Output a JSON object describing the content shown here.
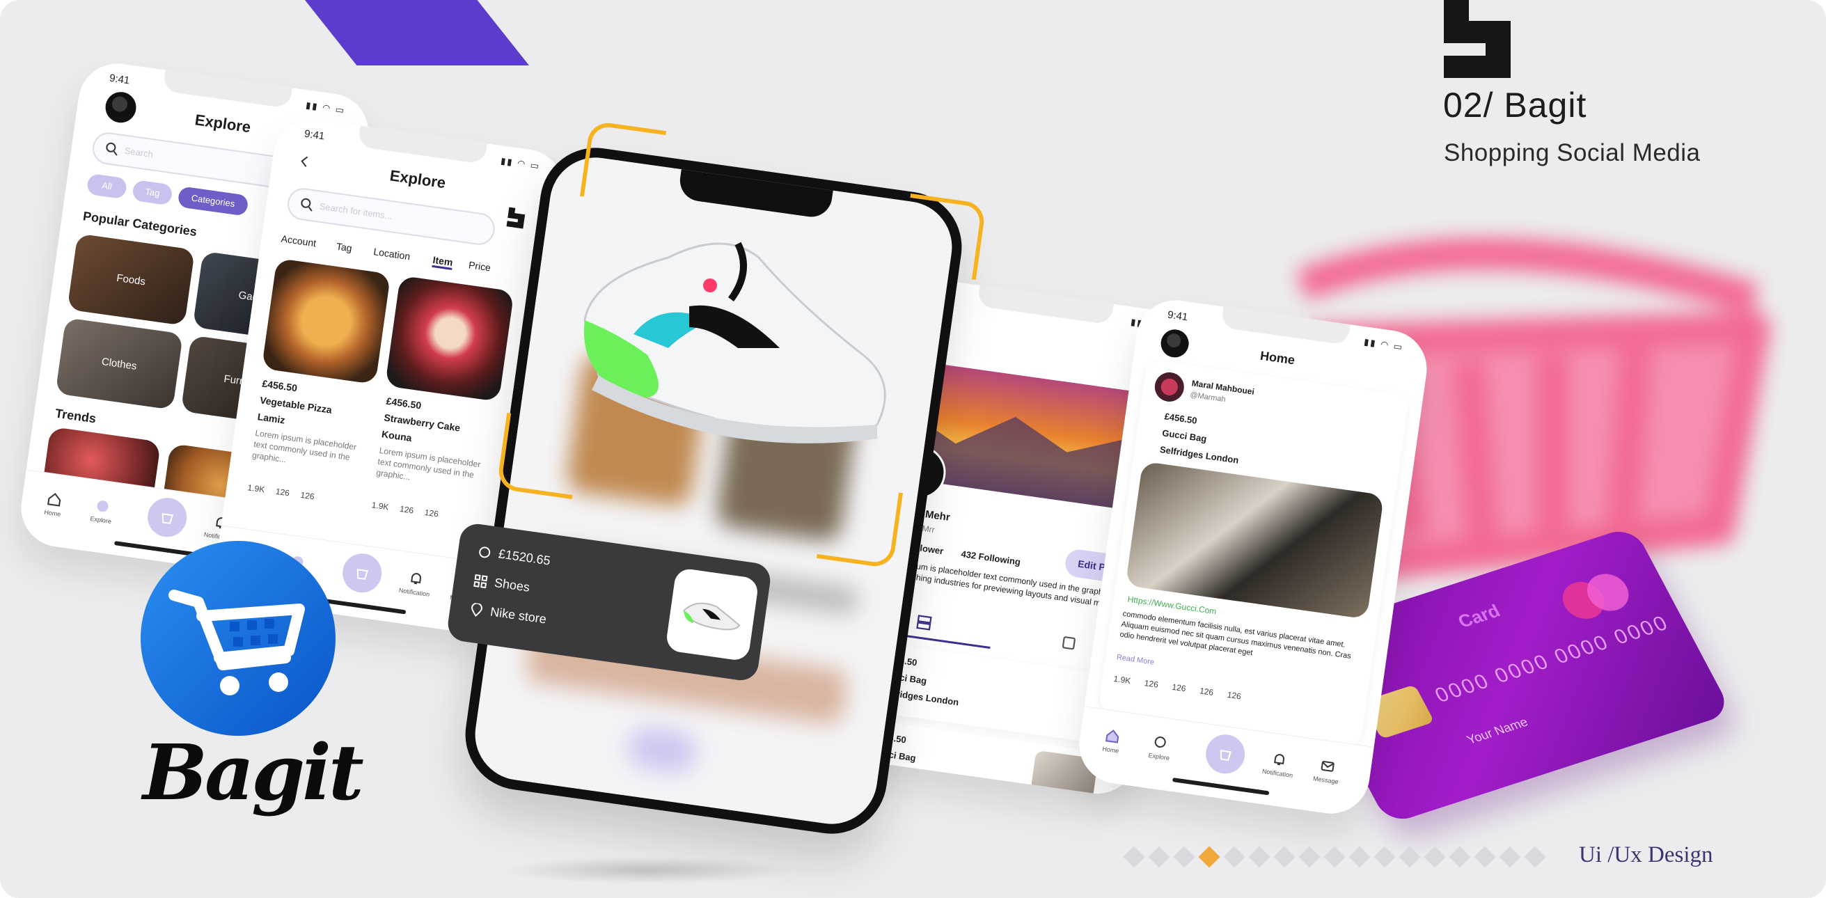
{
  "brand": {
    "project_title": "02/ Bagit",
    "project_subtitle": "Shopping Social Media",
    "wordmark": "Bagit",
    "footer_label": "Ui /Ux Design",
    "pager": {
      "count": 17,
      "active_index": 3
    },
    "accent": "#5b3ccc",
    "highlight": "#f2a93b"
  },
  "common": {
    "time": "9:41",
    "tabs": [
      "Home",
      "Explore",
      "Notification",
      "Message"
    ]
  },
  "phone_explore_1": {
    "title": "Explore",
    "search_placeholder": "Search",
    "filters": [
      "All",
      "Tag",
      "Categories"
    ],
    "active_filter": 2,
    "popular_heading": "Popular Categories",
    "categories": [
      "Foods",
      "Gadjets",
      "Clothes",
      "Furniture"
    ],
    "trends_heading": "Trends"
  },
  "phone_explore_2": {
    "title": "Explore",
    "search_placeholder": "Search for items...",
    "tabs": [
      "Account",
      "Tag",
      "Location",
      "Item",
      "Price"
    ],
    "active_tab": 3,
    "items": [
      {
        "price": "£456.50",
        "name": "Vegetable Pizza",
        "shop": "Lamiz",
        "desc": "Lorem ipsum is placeholder text commonly used in the graphic...",
        "likes": "1.9K",
        "comments": "126",
        "shares": "126"
      },
      {
        "price": "£456.50",
        "name": "Strawberry Cake",
        "shop": "Kouna",
        "desc": "Lorem ipsum is placeholder text commonly used in the graphic...",
        "likes": "1.9K",
        "comments": "126",
        "shares": "126"
      }
    ]
  },
  "product_card": {
    "price": "£1520.65",
    "category": "Shoes",
    "store": "Nike store"
  },
  "phone_profile": {
    "name": "Farbod Mehr",
    "handle": "@Farbod.Mrr",
    "followers": "121K Follower",
    "following": "432 Following",
    "bio": "Lorem ipsum is placeholder text commonly used in the graphic, print, and publishing industries for previewing layouts and visual mockups.",
    "edit_label": "Edit Profile",
    "posts": [
      {
        "price": "£456.50",
        "item": "Gucci Bag",
        "location": "Selfridges London"
      },
      {
        "price": "£456.50",
        "item": "Gucci Bag"
      }
    ]
  },
  "phone_home": {
    "title": "Home",
    "user": "Maral Mahbouei",
    "handle": "@Marmah",
    "price": "£456.50",
    "item": "Gucci Bag",
    "location": "Selfridges London",
    "link": "Https://Www.Gucci.Com",
    "caption": "commodo elementum facilisis nulla, est varius placerat vitae amet. Aliquam euismod nec sit quam cursus maximus venenatis non. Cras odio hendrerit vel volutpat placerat eget",
    "read_more": "Read More",
    "likes": "1.9K",
    "comments": "126",
    "shares": "126",
    "saves": "126",
    "views": "126"
  },
  "credit_card": {
    "brand": "Card",
    "number": "0000 0000 0000 0000",
    "holder": "Your Name"
  }
}
